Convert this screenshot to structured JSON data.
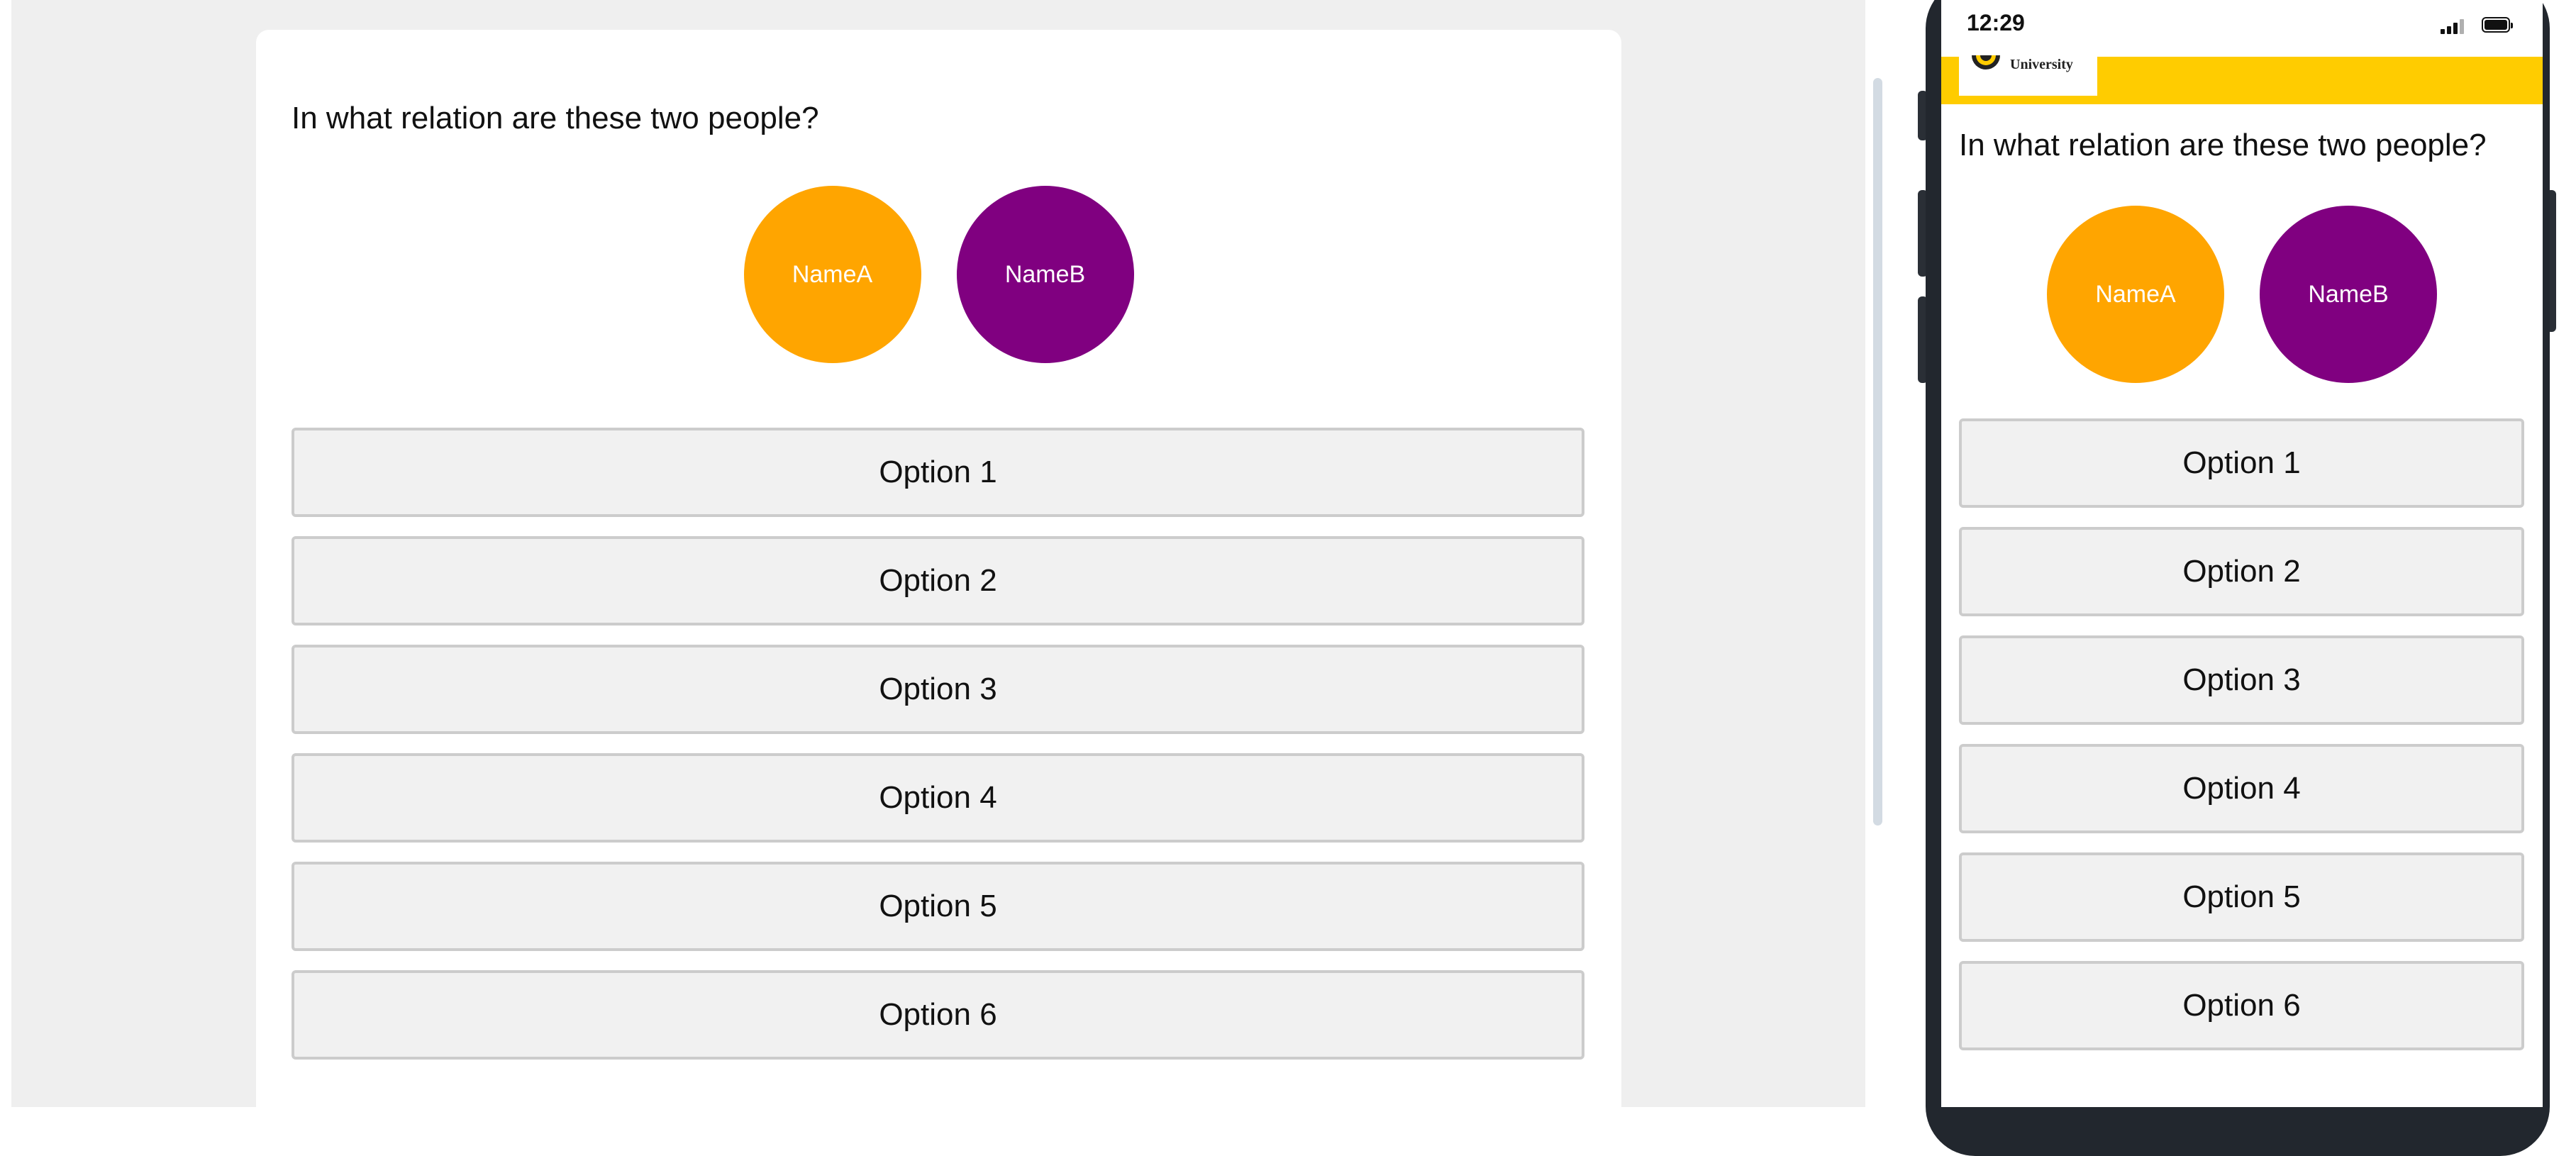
{
  "question": "In what relation are these two people?",
  "people": [
    {
      "name": "NameA",
      "color": "#ffa500"
    },
    {
      "name": "NameB",
      "color": "#800080"
    }
  ],
  "options": [
    "Option 1",
    "Option 2",
    "Option 3",
    "Option 4",
    "Option 5",
    "Option 6"
  ],
  "mobile": {
    "status_time": "12:29",
    "brand_color": "#ffcc00",
    "logo_text": "University",
    "icons": {
      "signal": "signal-icon",
      "battery": "battery-icon",
      "logo": "university-logo"
    }
  },
  "colors": {
    "page_background": "#efefef",
    "option_background": "#f1f1f1",
    "option_border": "#cccccc"
  }
}
